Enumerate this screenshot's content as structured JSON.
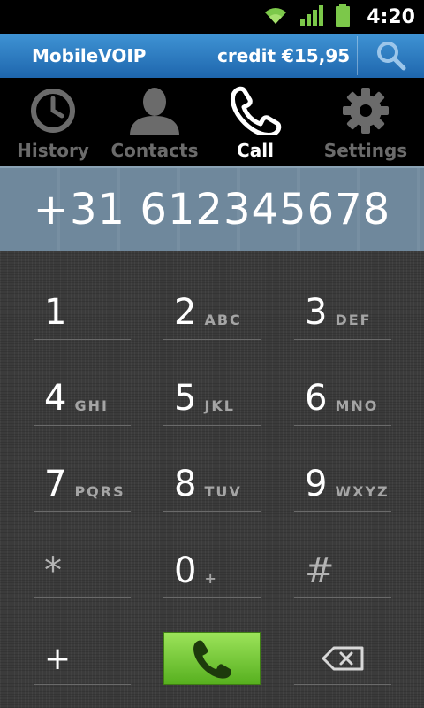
{
  "status_bar": {
    "time": "4:20",
    "icons": [
      "wifi-icon",
      "signal-icon",
      "battery-icon"
    ]
  },
  "title_bar": {
    "app_name": "MobileVOIP",
    "credit": "credit €15,95"
  },
  "tabs": [
    {
      "label": "History",
      "icon": "clock-icon",
      "active": false
    },
    {
      "label": "Contacts",
      "icon": "person-icon",
      "active": false
    },
    {
      "label": "Call",
      "icon": "phone-icon",
      "active": true
    },
    {
      "label": "Settings",
      "icon": "gear-icon",
      "active": false
    }
  ],
  "number": "+31 612345678",
  "keypad": {
    "k1": {
      "digit": "1",
      "letters": ""
    },
    "k2": {
      "digit": "2",
      "letters": "ABC"
    },
    "k3": {
      "digit": "3",
      "letters": "DEF"
    },
    "k4": {
      "digit": "4",
      "letters": "GHI"
    },
    "k5": {
      "digit": "5",
      "letters": "JKL"
    },
    "k6": {
      "digit": "6",
      "letters": "MNO"
    },
    "k7": {
      "digit": "7",
      "letters": "PQRS"
    },
    "k8": {
      "digit": "8",
      "letters": "TUV"
    },
    "k9": {
      "digit": "9",
      "letters": "WXYZ"
    },
    "star": {
      "digit": "*",
      "letters": ""
    },
    "k0": {
      "digit": "0",
      "letters": "+"
    },
    "hash": {
      "digit": "#",
      "letters": ""
    },
    "plus": {
      "digit": "+",
      "letters": ""
    }
  },
  "colors": {
    "accent": "#2f7fc6",
    "call_green": "#7ccb3d",
    "display_bg": "#6f889c"
  }
}
